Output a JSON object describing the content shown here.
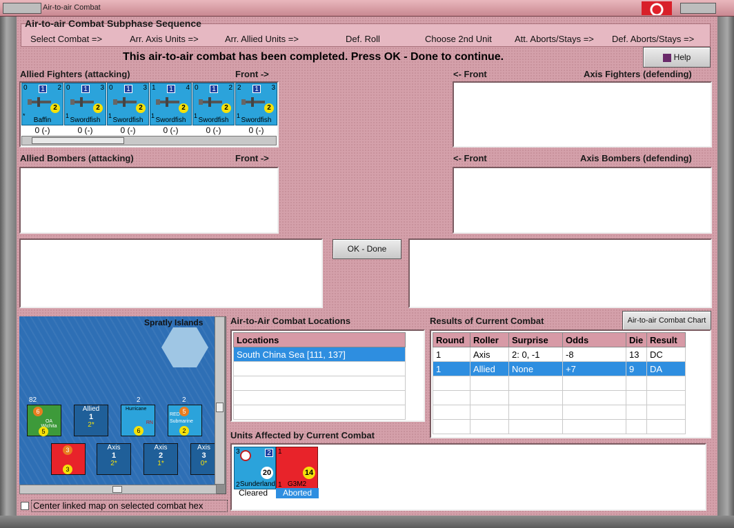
{
  "window": {
    "title": "Air-to-air Combat"
  },
  "sequence": {
    "header": "Air-to-air Combat Subphase Sequence",
    "steps": [
      "Select Combat =>",
      "Arr. Axis Units =>",
      "Arr. Allied Units =>",
      "Def. Roll",
      "Choose 2nd Unit",
      "Att. Aborts/Stays =>",
      "Def. Aborts/Stays =>"
    ]
  },
  "status_message": "This air-to-air combat has been completed.  Press OK - Done to continue.",
  "help_label": "Help",
  "allied_fighters": {
    "label": "Allied Fighters (attacking)",
    "front": "Front ->",
    "units": [
      {
        "name": "Baffin",
        "tl": "0",
        "tr": "2",
        "box": "1",
        "circle": "2",
        "bl": "*",
        "value": "0 (-)"
      },
      {
        "name": "Swordfish",
        "tl": "0",
        "tr": "3",
        "box": "1",
        "circle": "2",
        "bl": "1",
        "value": "0 (-)"
      },
      {
        "name": "Swordfish",
        "tl": "0",
        "tr": "3",
        "box": "1",
        "circle": "2",
        "bl": "1",
        "value": "0 (-)"
      },
      {
        "name": "Swordfish",
        "tl": "1",
        "tr": "4",
        "box": "1",
        "circle": "2",
        "bl": "1",
        "value": "0 (-)"
      },
      {
        "name": "Swordfish",
        "tl": "0",
        "tr": "2",
        "box": "1",
        "circle": "2",
        "bl": "1",
        "value": "0 (-)"
      },
      {
        "name": "Swordfish",
        "tl": "2",
        "tr": "3",
        "box": "1",
        "circle": "2",
        "bl": "1",
        "value": "0 (-)"
      }
    ]
  },
  "axis_fighters": {
    "label": "Axis Fighters (defending)",
    "front": "<- Front"
  },
  "allied_bombers": {
    "label": "Allied Bombers (attacking)",
    "front": "Front ->"
  },
  "axis_bombers": {
    "label": "Axis Bombers (defending)",
    "front": "<- Front"
  },
  "ok_done_label": "OK - Done",
  "map": {
    "title": "Spratly Islands",
    "labels": {
      "oa": "OA Wichita",
      "hurricane": "Hurricane",
      "submarine": "Submarine",
      "red": "RED",
      "ran": "RN",
      "allied_side": "Allied",
      "allied_num": "1",
      "allied_sub": "2*",
      "axis1_side": "Axis",
      "axis1_num": "1",
      "axis1_sub": "2*",
      "axis2_side": "Axis",
      "axis2_num": "2",
      "axis2_sub": "1*",
      "axis3_side": "Axis",
      "axis3_num": "3",
      "axis3_sub": "0*",
      "n82": "82",
      "n2a": "2",
      "n2b": "2"
    }
  },
  "center_map_label": "Center linked map on selected combat hex",
  "locations": {
    "title": "Air-to-Air Combat Locations",
    "column": "Locations",
    "items": [
      "South China Sea [111, 137]"
    ]
  },
  "results": {
    "title": "Results of Current Combat",
    "chart_button": "Air-to-air Combat Chart",
    "columns": [
      "Round",
      "Roller",
      "Surprise",
      "Odds",
      "Die",
      "Result"
    ],
    "rows": [
      [
        "1",
        "Axis",
        "2: 0, -1",
        "-8",
        "13",
        "DC"
      ],
      [
        "1",
        "Allied",
        "None",
        "+7",
        "9",
        "DA"
      ]
    ]
  },
  "affected": {
    "title": "Units Affected by Current Combat",
    "units": [
      {
        "name": "Sunderland",
        "status": "Cleared",
        "tl": "3",
        "box": "2",
        "circle": "20",
        "bl": "2"
      },
      {
        "name": "G3M2",
        "status": "Aborted",
        "tl": "1",
        "circle": "14",
        "bl": "1"
      }
    ]
  },
  "colors": {
    "background": "#d4a0aa",
    "allied_counter": "#2ba3db",
    "axis_counter": "#e8232a",
    "selection": "#2e8ee0"
  }
}
